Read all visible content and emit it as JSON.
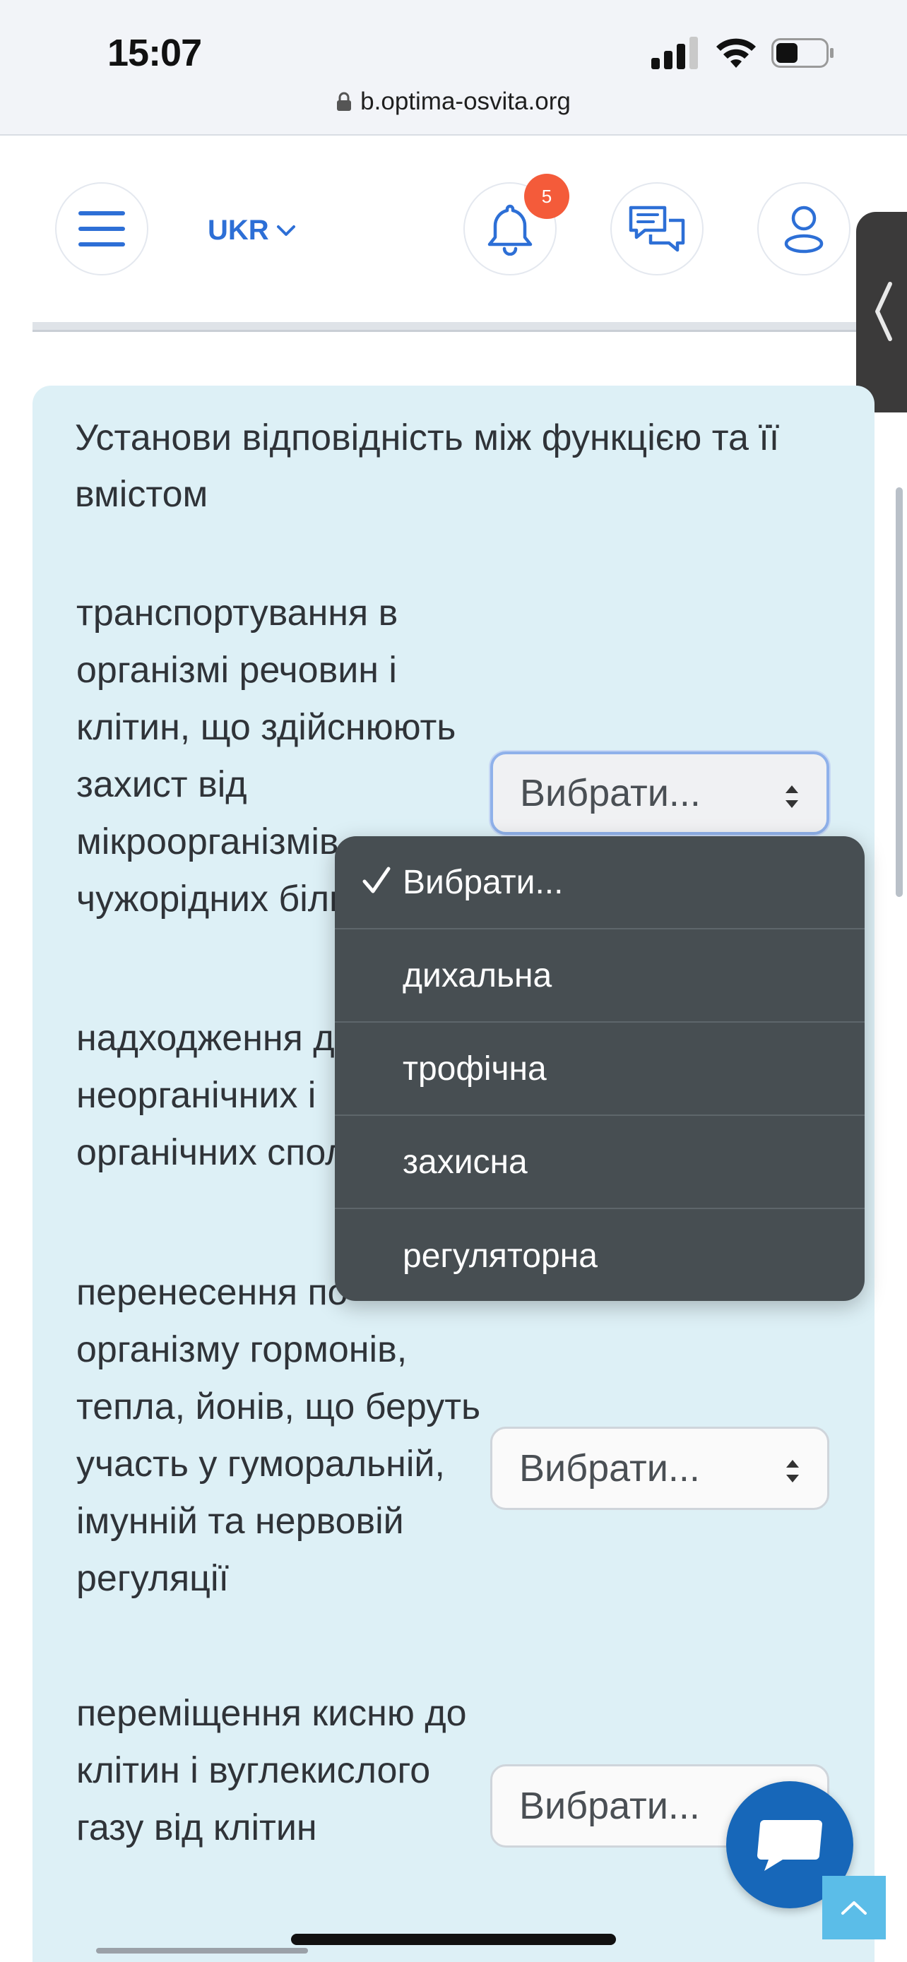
{
  "status_bar": {
    "time": "15:07",
    "url": "b.optima-osvita.org",
    "icons": [
      "cellular-signal-icon",
      "wifi-icon",
      "battery-icon",
      "lock-icon"
    ]
  },
  "header": {
    "language": "UKR",
    "notifications_count": "5",
    "icons": [
      "menu-icon",
      "chevron-down-icon",
      "bell-icon",
      "messages-icon",
      "user-icon",
      "chevron-left-icon"
    ]
  },
  "question": {
    "prompt": "Установи відповідність між функцією та її вмістом",
    "items": [
      {
        "text": "транспортування в організмі речовин і клітин, що здійснюють захист від мікроорганізмів, чужорідних білків тощо",
        "selected": "Вибрати..."
      },
      {
        "text": "надходження до клітин неорганічних і органічних сполук",
        "selected": "Вибрати..."
      },
      {
        "text": "перенесення по організму гормонів, тепла, йонів, що беруть участь у гуморальній, імунній та нервовій регуляції",
        "selected": "Вибрати..."
      },
      {
        "text": "переміщення кисню до клітин і вуглекислого газу від клітин",
        "selected": "Вибрати..."
      }
    ]
  },
  "dropdown": {
    "options": [
      "Вибрати...",
      "дихальна",
      "трофічна",
      "захисна",
      "регуляторна"
    ],
    "checked_index": 0
  },
  "colors": {
    "accent": "#2d6fd6",
    "badge": "#f45b3a",
    "card_bg": "#ddf0f6",
    "dropdown_bg": "#474e52",
    "chat_fab": "#1767b9",
    "scroll_top": "#5bbde8"
  }
}
